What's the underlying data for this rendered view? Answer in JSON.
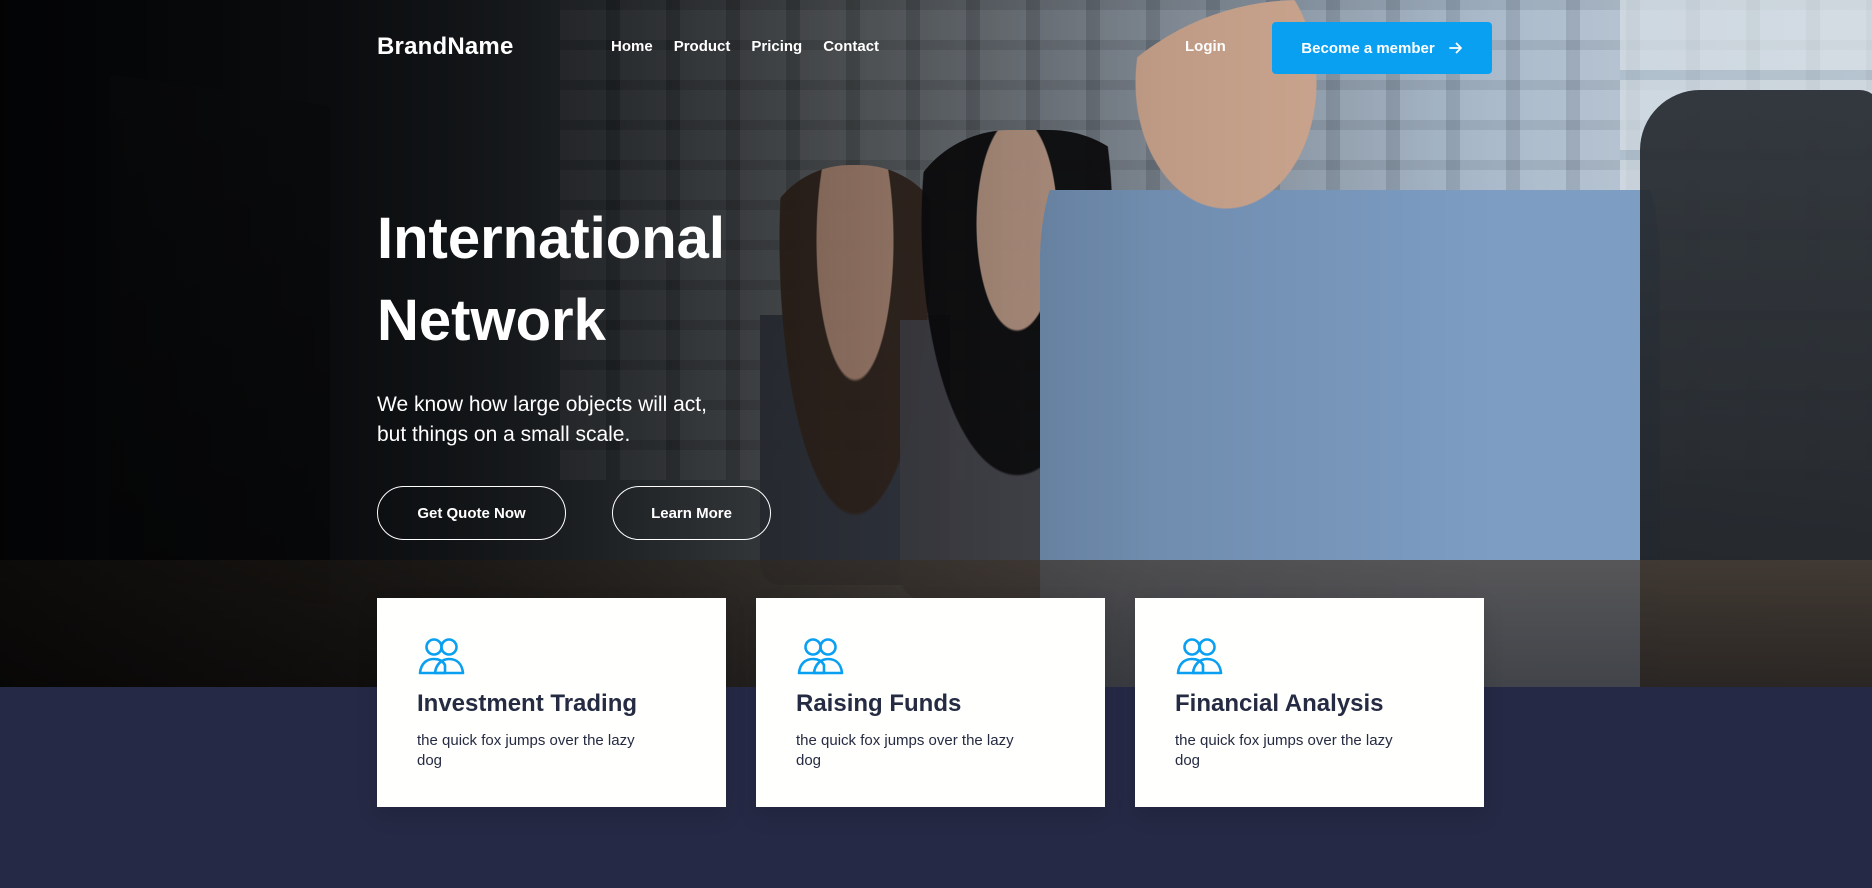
{
  "nav": {
    "brand": "BrandName",
    "links": [
      "Home",
      "Product",
      "Pricing",
      "Contact"
    ],
    "login": "Login",
    "cta": "Become a member"
  },
  "hero": {
    "title_lines": [
      "International",
      "Network"
    ],
    "subtitle_lines": [
      "We know how large objects will act,",
      "but things on a small scale."
    ],
    "primary_button": "Get Quote Now",
    "secondary_button": "Learn More"
  },
  "cards": [
    {
      "icon": "users-icon",
      "title": "Investment Trading",
      "text": "the quick fox jumps over the lazy dog"
    },
    {
      "icon": "users-icon",
      "title": "Raising Funds",
      "text": "the quick fox jumps over the lazy dog"
    },
    {
      "icon": "users-icon",
      "title": "Financial Analysis",
      "text": "the quick fox jumps over the lazy dog"
    }
  ],
  "colors": {
    "accent": "#0aa0f2",
    "dark_section": "#252945",
    "card_text": "#252b42",
    "white": "#ffffff"
  }
}
